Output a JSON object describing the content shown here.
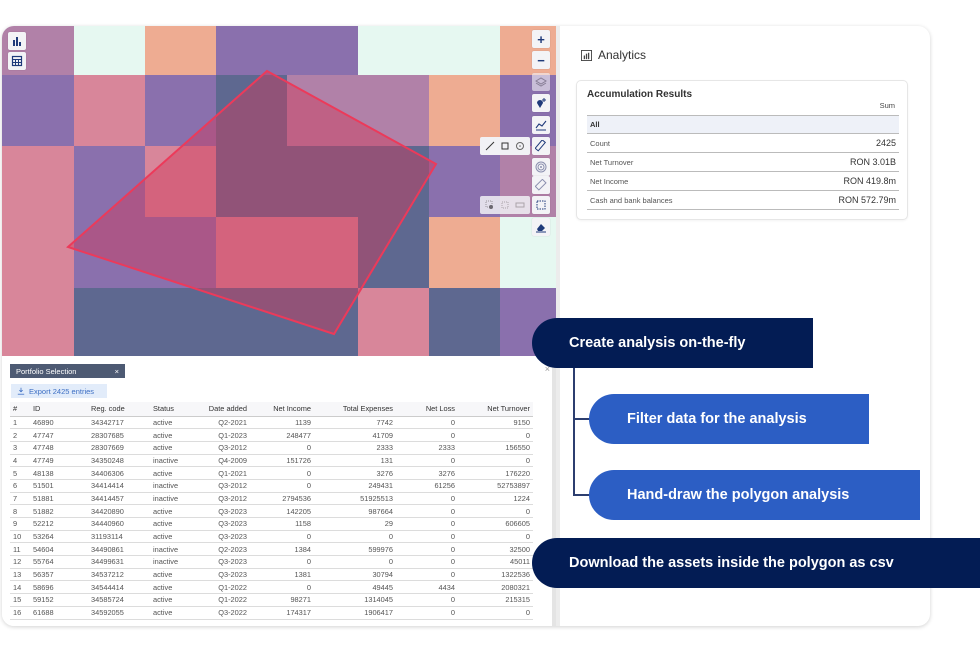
{
  "map": {
    "left_controls": [
      {
        "icon": "bar-chart-icon"
      },
      {
        "icon": "calculator-icon"
      }
    ],
    "right_controls": [
      {
        "icon": "zoom-in-icon",
        "glyph": "+"
      },
      {
        "icon": "zoom-out-icon",
        "glyph": "−"
      },
      {
        "icon": "layers-icon"
      },
      {
        "icon": "location-add-icon"
      },
      {
        "icon": "line-chart-icon"
      },
      {
        "icon": "ruler-icon"
      },
      {
        "icon": "target-icon"
      },
      {
        "icon": "tag-icon"
      },
      {
        "icon": "polygon-select-icon"
      },
      {
        "icon": "eraser-icon"
      }
    ],
    "measure_tools": [
      "line-icon",
      "area-icon",
      "circle-icon"
    ],
    "select_tools": [
      "pointer-select-icon",
      "square-select-icon",
      "rectangle-select-icon"
    ],
    "colors": {
      "mint": "#e6f8f1",
      "peach": "#eeac92",
      "purple": "#8a70ad",
      "mauve": "#b181a8",
      "pink": "#d8869a",
      "navy": "#5e6890",
      "polygon_stroke": "#ec3a5a",
      "polygon_fill": "#d03a5a"
    }
  },
  "panel": {
    "tab_label": "Portfolio Selection",
    "tab_close": "×",
    "panel_close": "×",
    "export_label": "Export 2425 entries",
    "columns": [
      "#",
      "ID",
      "Reg. code",
      "Status",
      "Date added",
      "Net Income",
      "Total Expenses",
      "Net Loss",
      "Net Turnover"
    ],
    "rows": [
      [
        "1",
        "46890",
        "34342717",
        "active",
        "Q2-2021",
        "1139",
        "7742",
        "0",
        "9150"
      ],
      [
        "2",
        "47747",
        "28307685",
        "active",
        "Q1-2023",
        "248477",
        "41709",
        "0",
        "0"
      ],
      [
        "3",
        "47748",
        "28307669",
        "active",
        "Q3-2012",
        "0",
        "2333",
        "2333",
        "156550"
      ],
      [
        "4",
        "47749",
        "34350248",
        "inactive",
        "Q4-2009",
        "151726",
        "131",
        "0",
        "0"
      ],
      [
        "5",
        "48138",
        "34406306",
        "active",
        "Q1-2021",
        "0",
        "3276",
        "3276",
        "176220"
      ],
      [
        "6",
        "51501",
        "34414414",
        "inactive",
        "Q3-2012",
        "0",
        "249431",
        "61256",
        "52753897"
      ],
      [
        "7",
        "51881",
        "34414457",
        "inactive",
        "Q3-2012",
        "2794536",
        "51925513",
        "0",
        "1224"
      ],
      [
        "8",
        "51882",
        "34420890",
        "active",
        "Q3-2023",
        "142205",
        "987664",
        "0",
        "0"
      ],
      [
        "9",
        "52212",
        "34440960",
        "active",
        "Q3-2023",
        "1158",
        "29",
        "0",
        "606605"
      ],
      [
        "10",
        "53264",
        "31193114",
        "active",
        "Q3-2023",
        "0",
        "0",
        "0",
        "0"
      ],
      [
        "11",
        "54604",
        "34490861",
        "inactive",
        "Q2-2023",
        "1384",
        "599976",
        "0",
        "32500"
      ],
      [
        "12",
        "55764",
        "34499631",
        "inactive",
        "Q3-2023",
        "0",
        "0",
        "0",
        "45011"
      ],
      [
        "13",
        "56357",
        "34537212",
        "active",
        "Q3-2023",
        "1381",
        "30794",
        "0",
        "1322536"
      ],
      [
        "14",
        "58696",
        "34544414",
        "active",
        "Q1-2022",
        "0",
        "49445",
        "4434",
        "2080321"
      ],
      [
        "15",
        "59152",
        "34585724",
        "active",
        "Q1-2022",
        "98271",
        "1314045",
        "0",
        "215315"
      ],
      [
        "16",
        "61688",
        "34592055",
        "active",
        "Q3-2022",
        "174317",
        "1906417",
        "0",
        "0"
      ]
    ]
  },
  "analytics": {
    "title": "Analytics",
    "card_title": "Accumulation Results",
    "sum_label": "Sum",
    "group_label": "All",
    "rows": [
      {
        "label": "Count",
        "value": "2425"
      },
      {
        "label": "Net Turnover",
        "value": "RON 3.01B"
      },
      {
        "label": "Net Income",
        "value": "RON 419.8m"
      },
      {
        "label": "Cash and bank balances",
        "value": "RON 572.79m"
      }
    ]
  },
  "callouts": {
    "create": "Create analysis on-the-fly",
    "filter": "Filter data for the analysis",
    "handdraw": "Hand-draw the polygon analysis",
    "download": "Download the assets inside the polygon  as csv",
    "dark_color": "#031c54",
    "light_color": "#2c5ec4"
  }
}
